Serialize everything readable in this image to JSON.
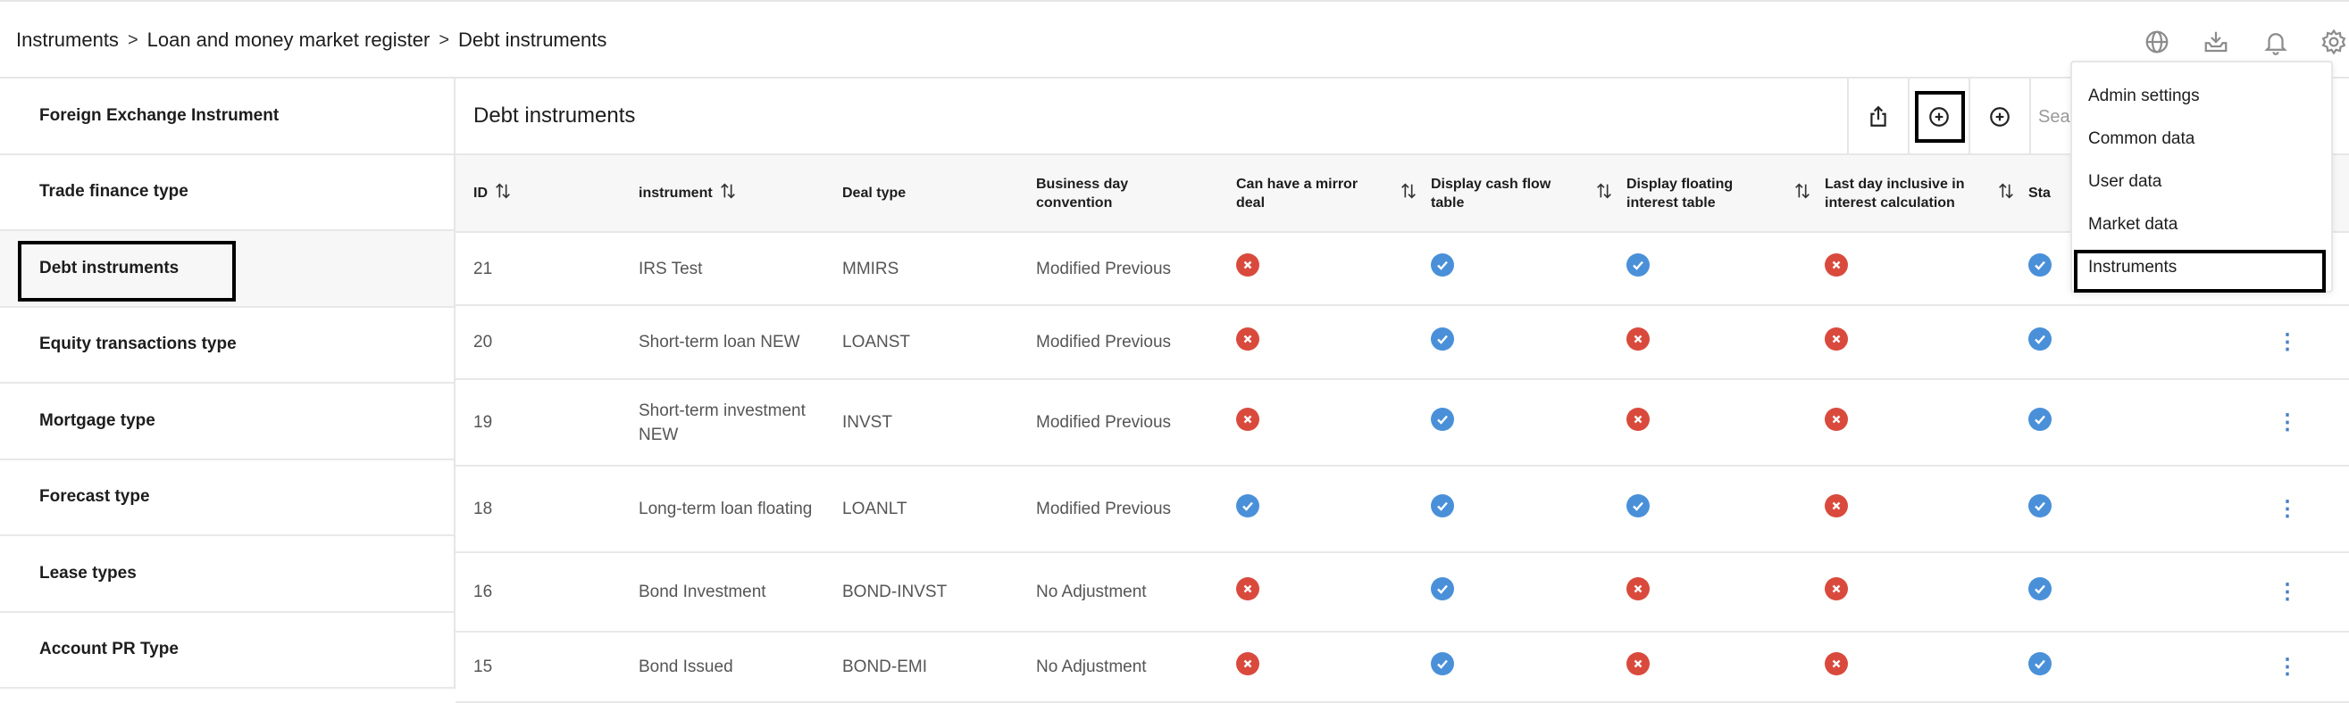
{
  "breadcrumb": [
    "Instruments",
    "Loan and money market register",
    "Debt instruments"
  ],
  "top_icons": [
    "globe-icon",
    "inbox-download-icon",
    "bell-icon",
    "gear-icon"
  ],
  "sidebar": {
    "items": [
      {
        "label": "Foreign Exchange Instrument"
      },
      {
        "label": "Trade finance type"
      },
      {
        "label": "Debt instruments",
        "active": true
      },
      {
        "label": "Equity transactions type"
      },
      {
        "label": "Mortgage type"
      },
      {
        "label": "Forecast type"
      },
      {
        "label": "Lease types"
      },
      {
        "label": "Account PR Type"
      }
    ]
  },
  "main": {
    "title": "Debt instruments",
    "toolbar": {
      "share_icon": "share-icon",
      "add_icon": "plus-circle-icon",
      "add2_icon": "plus-circle-icon",
      "search_placeholder": "Search"
    }
  },
  "table": {
    "columns": [
      {
        "label": "ID",
        "sortable": true
      },
      {
        "label": "instrument",
        "sortable": true
      },
      {
        "label": "Deal type",
        "sortable": false
      },
      {
        "label": "Business day convention",
        "sortable": false
      },
      {
        "label": "Can have a mirror deal",
        "sortable": true
      },
      {
        "label": "Display cash flow table",
        "sortable": true
      },
      {
        "label": "Display floating interest table",
        "sortable": true
      },
      {
        "label": "Last day inclusive in interest calculation",
        "sortable": true
      },
      {
        "label": "Sta",
        "sortable": false
      }
    ],
    "rows": [
      {
        "id": "21",
        "instrument": "IRS Test",
        "deal_type": "MMIRS",
        "bdc": "Modified Previous",
        "mirror": false,
        "cashflow": true,
        "floating": true,
        "lastday": false,
        "status": true
      },
      {
        "id": "20",
        "instrument": "Short-term loan NEW",
        "deal_type": "LOANST",
        "bdc": "Modified Previous",
        "mirror": false,
        "cashflow": true,
        "floating": false,
        "lastday": false,
        "status": true
      },
      {
        "id": "19",
        "instrument": "Short-term investment NEW",
        "deal_type": "INVST",
        "bdc": "Modified Previous",
        "mirror": false,
        "cashflow": true,
        "floating": false,
        "lastday": false,
        "status": true
      },
      {
        "id": "18",
        "instrument": "Long-term loan floating",
        "deal_type": "LOANLT",
        "bdc": "Modified Previous",
        "mirror": true,
        "cashflow": true,
        "floating": true,
        "lastday": false,
        "status": true
      },
      {
        "id": "16",
        "instrument": "Bond Investment",
        "deal_type": "BOND-INVST",
        "bdc": "No Adjustment",
        "mirror": false,
        "cashflow": true,
        "floating": false,
        "lastday": false,
        "status": true
      },
      {
        "id": "15",
        "instrument": "Bond Issued",
        "deal_type": "BOND-EMI",
        "bdc": "No Adjustment",
        "mirror": false,
        "cashflow": true,
        "floating": false,
        "lastday": false,
        "status": true
      }
    ]
  },
  "dropdown": {
    "items": [
      "Admin settings",
      "Common data",
      "User data",
      "Market data",
      "Instruments"
    ]
  },
  "colors": {
    "yes": "#4a90d9",
    "no": "#d94a3d"
  }
}
